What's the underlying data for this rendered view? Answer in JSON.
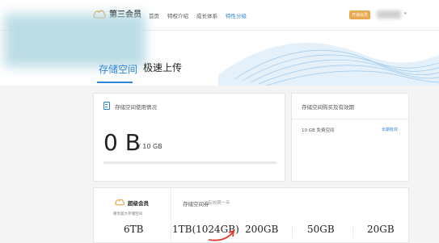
{
  "header": {
    "logo_text": "第三会员",
    "nav": [
      "首页",
      "特权介绍",
      "成长体系",
      "特性分级"
    ],
    "open_button": "开通会员"
  },
  "tabs": [
    "存储空间",
    "极速上传"
  ],
  "usage": {
    "title": "存储空间使用情况",
    "used": "0 B",
    "total": "/ 10 GB",
    "progress": 0
  },
  "history": {
    "title": "存储空间购买及有效期",
    "space": "10 GB 免费空间",
    "valid": "长期有效"
  },
  "vip": {
    "title": "超级会员",
    "subtitle": "赠享超大存储空间"
  },
  "coupon": {
    "title": "存储空间券",
    "valid": "有效期一年"
  },
  "plans": [
    "6TB",
    "1TB(1024GB)",
    "200GB",
    "50GB",
    "20GB"
  ],
  "colors": {
    "accent": "#2f86d6",
    "gold": "#e8a84d"
  }
}
